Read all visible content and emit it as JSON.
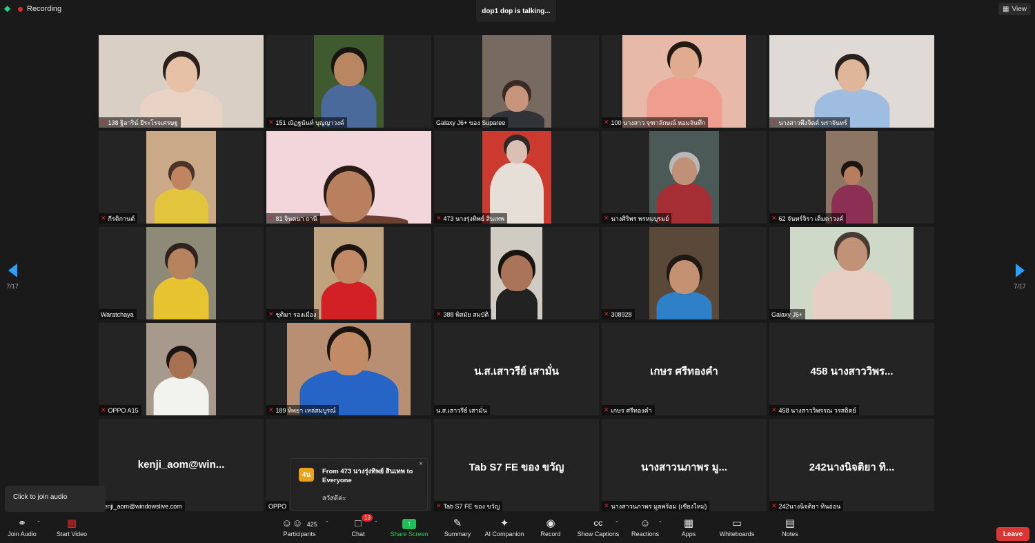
{
  "top": {
    "recording_label": "Recording",
    "talking_banner": "dop1 dop is talking...",
    "view_label": "View"
  },
  "nav": {
    "page_left": "7/17",
    "page_right": "7/17"
  },
  "tiles": [
    {
      "label": "138 ฐิลาริน์ ยีระโรจเศรษฐ",
      "muted": true
    },
    {
      "label": "151 ณัฏฐนันท์ บุญญาวงค์",
      "muted": true
    },
    {
      "label": "Galaxy J6+ ของ Suparee",
      "muted": false
    },
    {
      "label": "100 นางสาว จุฑาลักษณ์ หอมจันทึก",
      "muted": true
    },
    {
      "label": "นางสาวพึงจิตต์ นราจันทร์",
      "muted": true
    },
    {
      "label": "กีรติกานต์",
      "muted": true
    },
    {
      "label": "81 จินตนา ถานี",
      "muted": true
    },
    {
      "label": "473 นางรุ่งทิพย์ สินเทพ",
      "muted": true
    },
    {
      "label": "นางศิริพร พรหมบุรมย์",
      "muted": true
    },
    {
      "label": "62 จันทร์จิรา เต็มดาวงค์",
      "muted": true
    },
    {
      "label": "Waratchaya",
      "muted": false
    },
    {
      "label": "ชุติมา รองเมือง",
      "muted": true
    },
    {
      "label": "388 พิสมัย สมบัติ",
      "muted": true
    },
    {
      "label": "308928",
      "muted": true
    },
    {
      "label": "Galaxy J6+",
      "muted": false
    },
    {
      "label": "OPPO A15",
      "muted": true
    },
    {
      "label": "189 ทิพยา เหล่สมบูรณ์",
      "muted": true
    },
    {
      "label": "น.ส.เสาวรีย์ เสามั่น",
      "muted": false,
      "big": "น.ส.เสาวรีย์ เสามั่น"
    },
    {
      "label": "เกษร ศรีทองคำ",
      "muted": true,
      "big": "เกษร ศรีทองคำ"
    },
    {
      "label": "458 นางสาววิพรรณ วรสถิตย์",
      "muted": true,
      "big": "458 นางสาววิพร..."
    },
    {
      "label": "kenji_aom@windowslive.com",
      "muted": false,
      "big": "kenji_aom@win..."
    },
    {
      "label": "OPPO",
      "muted": false
    },
    {
      "label": "Tab S7 FE ของ ขวัญ",
      "muted": true,
      "big": "Tab S7 FE ของ ขวัญ"
    },
    {
      "label": "นางสาวนภาพร มูลพร้อม (เชียงใหม่)",
      "muted": true,
      "big": "นางสาวนภาพร มู..."
    },
    {
      "label": "242นางนิจติยา ทินอ่อน",
      "muted": true,
      "big": "242นางนิจติยา ทิ..."
    }
  ],
  "join_tip": "Click to join audio",
  "chat_popup": {
    "avatar": "4น",
    "from": "From 473 นางรุ่งทิพย์ สินเทพ to Everyone",
    "message": "สวัสดีค่ะ",
    "close_icon": "×"
  },
  "toolbar": {
    "join_audio": "Join Audio",
    "start_video": "Start Video",
    "participants": "Participants",
    "participants_count": "425",
    "chat": "Chat",
    "chat_badge": "13",
    "share_screen": "Share Screen",
    "summary": "Summary",
    "ai_companion": "AI Companion",
    "record": "Record",
    "show_captions": "Show Captions",
    "reactions": "Reactions",
    "apps": "Apps",
    "whiteboards": "Whiteboards",
    "notes": "Notes",
    "leave": "Leave"
  },
  "colors": {
    "accent_blue": "#2da0ff",
    "share_green": "#1fbd55",
    "leave_red": "#d93636",
    "mute_red": "#e02828"
  }
}
